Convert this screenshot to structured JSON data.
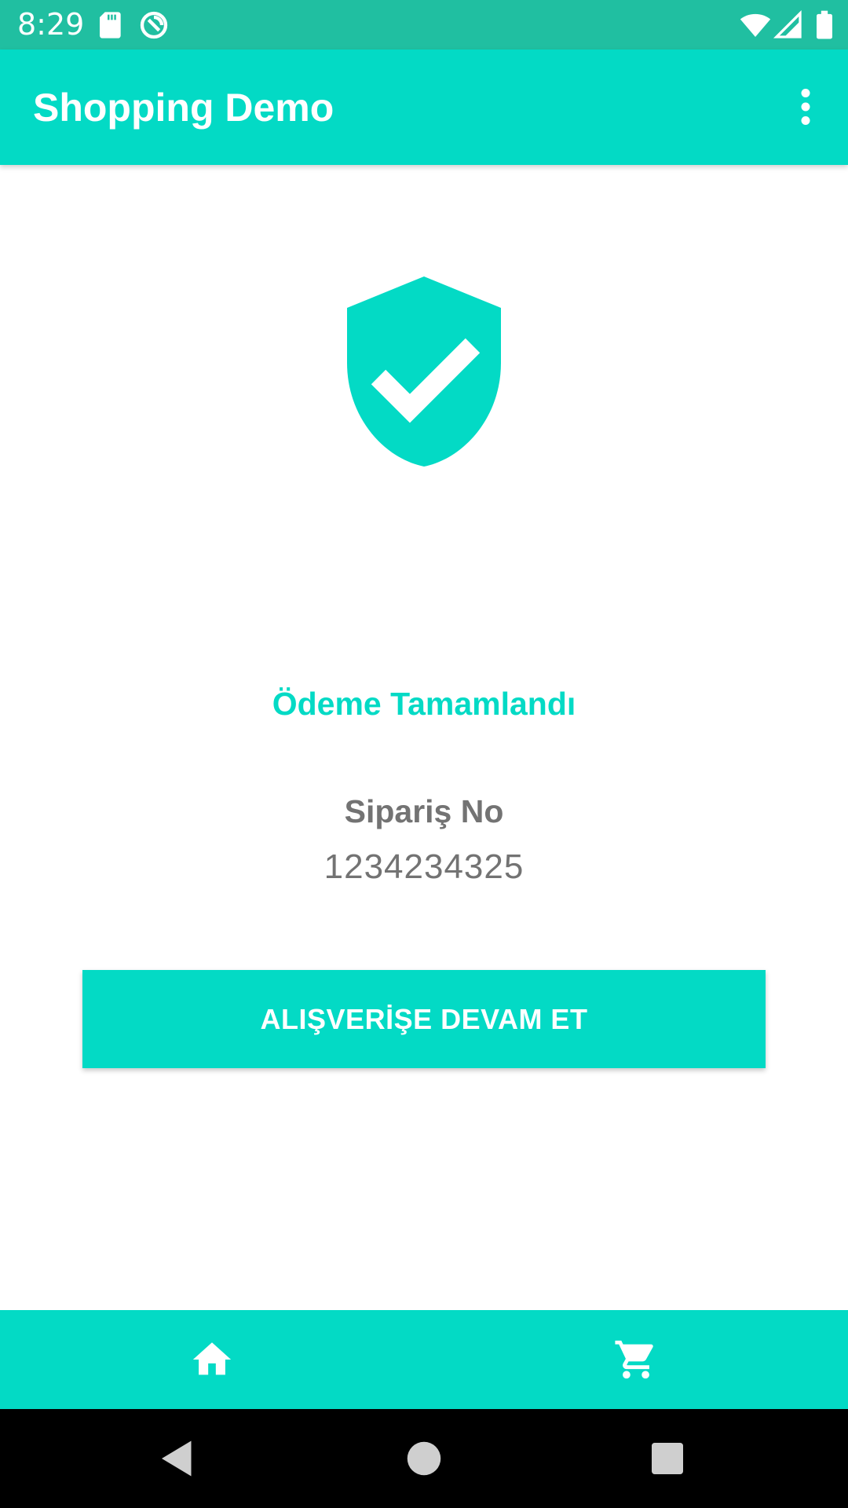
{
  "status_bar": {
    "time": "8:29",
    "icons": [
      "sd-card-icon",
      "sync-icon",
      "wifi-icon",
      "signal-icon",
      "battery-icon"
    ]
  },
  "app_bar": {
    "title": "Shopping Demo",
    "menu_icon": "more-vert-icon"
  },
  "content": {
    "status_icon": "shield-check-icon",
    "success_title": "Ödeme Tamamlandı",
    "order_label": "Sipariş No",
    "order_number": "1234234325",
    "continue_button_label": "ALIŞVERİŞE DEVAM ET"
  },
  "bottom_nav": {
    "items": [
      {
        "icon": "home-icon"
      },
      {
        "icon": "shopping-cart-icon"
      }
    ]
  },
  "system_nav": {
    "buttons": [
      "back-icon",
      "home-circle-icon",
      "recents-icon"
    ]
  },
  "colors": {
    "accent": "#03dac5",
    "status_bar": "#20bfa1",
    "secondary_text": "#737373"
  }
}
